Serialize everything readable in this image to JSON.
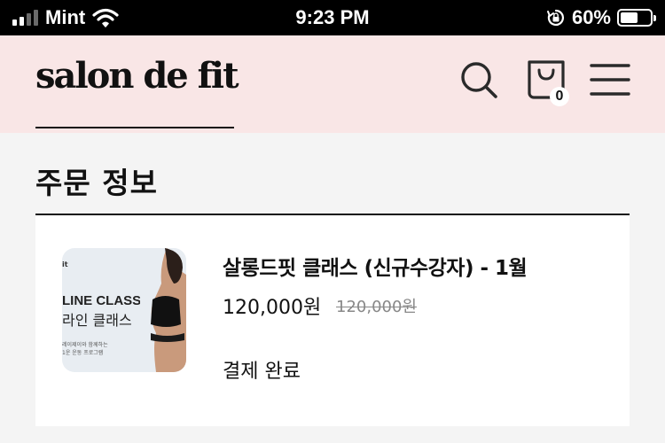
{
  "status_bar": {
    "carrier": "Mint",
    "time": "9:23 PM",
    "battery_pct": "60%",
    "battery_level": 0.6,
    "signal_bars": 2
  },
  "header": {
    "logo": "salon de fit",
    "cart_count": "0",
    "background_color": "#f9e6e6",
    "icons": [
      "search-icon",
      "shopping-bag-icon",
      "hamburger-menu-icon"
    ]
  },
  "order_info": {
    "title": "주문 정보",
    "items": [
      {
        "thumbnail": {
          "brand": "it",
          "en_text": "LINE CLASS",
          "ko_text": "라인 클래스",
          "desc_line1": "레이제이와 함께하는",
          "desc_line2": "1운 운동 프로그램"
        },
        "name": "살롱드핏 클래스 (신규수강자) - 1월",
        "price": "120,000원",
        "original_price": "120,000원",
        "status": "결제 완료"
      }
    ]
  }
}
